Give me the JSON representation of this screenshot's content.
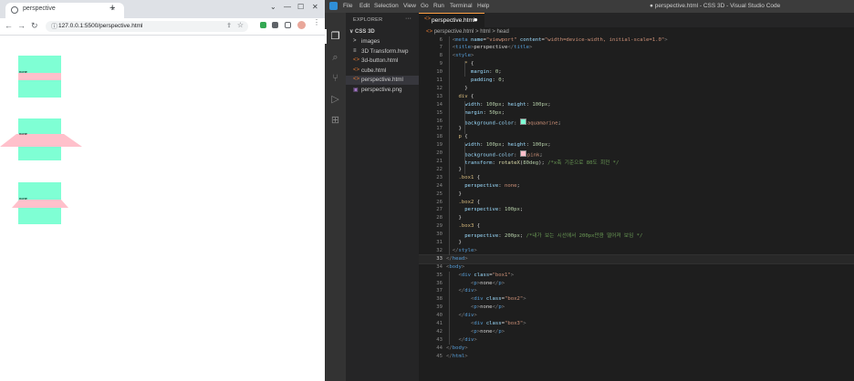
{
  "browser": {
    "tab_title": "perspective",
    "tab_close": "×",
    "new_tab": "+",
    "url": "127.0.0.1:5500/perspective.html",
    "demo_boxes": [
      {
        "class": "box1",
        "text": "none",
        "perspective": "none"
      },
      {
        "class": "box2",
        "text": "none",
        "perspective": "100px"
      },
      {
        "class": "box3",
        "text": "none",
        "perspective": "200px"
      }
    ],
    "colors": {
      "box": "#7fffd4",
      "p": "#ffc0cb"
    }
  },
  "vscode": {
    "menu": [
      "File",
      "Edit",
      "Selection",
      "View",
      "Go",
      "Run",
      "Terminal",
      "Help"
    ],
    "window_title": "● perspective.html - CSS 3D - Visual Studio Code",
    "explorer": {
      "title": "EXPLORER",
      "more": "···",
      "root": "∨ CSS 3D",
      "items": [
        {
          "label": "images",
          "icon": ">",
          "icon_name": "folder-chevron-icon",
          "active": false
        },
        {
          "label": "3D Transform.hwp",
          "icon": "≡",
          "icon_name": "hwp-file-icon",
          "active": false
        },
        {
          "label": "3d-button.html",
          "icon": "<>",
          "icon_name": "html-file-icon",
          "active": false
        },
        {
          "label": "cube.html",
          "icon": "<>",
          "icon_name": "html-file-icon",
          "active": false
        },
        {
          "label": "perspective.html",
          "icon": "<>",
          "icon_name": "html-file-icon",
          "active": true
        },
        {
          "label": "perspective.png",
          "icon": "▣",
          "icon_name": "image-file-icon",
          "active": false
        }
      ]
    },
    "editor_tab": {
      "label": "perspective.html",
      "dirty": "●"
    },
    "breadcrumbs": {
      "file": "perspective.html",
      "sep1": ">",
      "n1": "html",
      "sep2": ">",
      "n2": "head"
    },
    "code_lines": [
      {
        "n": "6",
        "html": "  <span class=\"t\">&lt;</span><span class=\"tg\">meta</span> <span class=\"at\">name</span>=<span class=\"sv\">\"viewport\"</span> <span class=\"at\">content</span>=<span class=\"sv\">\"width=device-width, initial-scale=1.0\"</span><span class=\"t\">&gt;</span>"
      },
      {
        "n": "7",
        "html": "  <span class=\"t\">&lt;</span><span class=\"tg\">title</span><span class=\"t\">&gt;</span>perspective<span class=\"t\">&lt;/</span><span class=\"tg\">title</span><span class=\"t\">&gt;</span>"
      },
      {
        "n": "8",
        "html": "  <span class=\"t\">&lt;</span><span class=\"tg\">style</span><span class=\"t\">&gt;</span>"
      },
      {
        "n": "9",
        "html": "      <span class=\"sel\">*</span> {"
      },
      {
        "n": "10",
        "html": "        <span class=\"pr\">margin</span>: <span class=\"nu\">0</span>;"
      },
      {
        "n": "11",
        "html": "        <span class=\"pr\">padding</span>: <span class=\"nu\">0</span>;"
      },
      {
        "n": "12",
        "html": "      }"
      },
      {
        "n": "13",
        "html": "    <span class=\"sel\">div</span> {"
      },
      {
        "n": "14",
        "html": "      <span class=\"pr\">width</span>: <span class=\"nu\">100px</span>; <span class=\"pr\">height</span>: <span class=\"nu\">100px</span>;"
      },
      {
        "n": "15",
        "html": "      <span class=\"pr\">margin</span>: <span class=\"nu\">50px</span>;"
      },
      {
        "n": "16",
        "html": "      <span class=\"pr\">background-color</span>: <span class=\"swatch\" style=\"background:#7fffd4\"></span><span class=\"kw\">aquamarine</span>;"
      },
      {
        "n": "17",
        "html": "    }"
      },
      {
        "n": "18",
        "html": "    <span class=\"sel\">p</span> {"
      },
      {
        "n": "19",
        "html": "      <span class=\"pr\">width</span>: <span class=\"nu\">100px</span>; <span class=\"pr\">height</span>: <span class=\"nu\">100px</span>;"
      },
      {
        "n": "20",
        "html": "      <span class=\"pr\">background-color</span>: <span class=\"swatch\" style=\"background:#ffc0cb\"></span><span class=\"kw\">pink</span>;"
      },
      {
        "n": "21",
        "html": "      <span class=\"pr\">transform</span>: <span class=\"fn\">rotateX</span>(<span class=\"nu\">80deg</span>); <span class=\"cm\">/*x축 기준으로 80도 회전 */</span>"
      },
      {
        "n": "22",
        "html": "    }"
      },
      {
        "n": "23",
        "html": "    <span class=\"sel\">.box1</span> {"
      },
      {
        "n": "24",
        "html": "      <span class=\"pr\">perspective</span>: <span class=\"kw\">none</span>;"
      },
      {
        "n": "25",
        "html": "    }"
      },
      {
        "n": "26",
        "html": "    <span class=\"sel\">.box2</span> {"
      },
      {
        "n": "27",
        "html": "      <span class=\"pr\">perspective</span>: <span class=\"nu\">100px</span>;"
      },
      {
        "n": "28",
        "html": "    }"
      },
      {
        "n": "29",
        "html": "    <span class=\"sel\">.box3</span> {"
      },
      {
        "n": "30",
        "html": "      <span class=\"pr\">perspective</span>: <span class=\"nu\">200px</span>; <span class=\"cm\">/*내가 보는 시선에서 200px만큼 떨어져 보임 */</span>"
      },
      {
        "n": "31",
        "html": "    }"
      },
      {
        "n": "32",
        "html": "  <span class=\"t\">&lt;/</span><span class=\"tg\">style</span><span class=\"t\">&gt;</span>"
      },
      {
        "n": "33",
        "html": "<span class=\"t\">&lt;/</span><span class=\"tg\">head</span><span class=\"t\">&gt;</span>"
      },
      {
        "n": "34",
        "html": "<span class=\"t\">&lt;</span><span class=\"tg\">body</span><span class=\"t\">&gt;</span>"
      },
      {
        "n": "35",
        "html": "    <span class=\"t\">&lt;</span><span class=\"tg\">div</span> <span class=\"at\">class</span>=<span class=\"sv\">\"box1\"</span><span class=\"t\">&gt;</span>"
      },
      {
        "n": "36",
        "html": "        <span class=\"t\">&lt;</span><span class=\"tg\">p</span><span class=\"t\">&gt;</span>none<span class=\"t\">&lt;/</span><span class=\"tg\">p</span><span class=\"t\">&gt;</span>"
      },
      {
        "n": "37",
        "html": "    <span class=\"t\">&lt;/</span><span class=\"tg\">div</span><span class=\"t\">&gt;</span>"
      },
      {
        "n": "38",
        "html": "        <span class=\"t\">&lt;</span><span class=\"tg\">div</span> <span class=\"at\">class</span>=<span class=\"sv\">\"box2\"</span><span class=\"t\">&gt;</span>"
      },
      {
        "n": "39",
        "html": "        <span class=\"t\">&lt;</span><span class=\"tg\">p</span><span class=\"t\">&gt;</span>none<span class=\"t\">&lt;/</span><span class=\"tg\">p</span><span class=\"t\">&gt;</span>"
      },
      {
        "n": "40",
        "html": "    <span class=\"t\">&lt;/</span><span class=\"tg\">div</span><span class=\"t\">&gt;</span>"
      },
      {
        "n": "41",
        "html": "        <span class=\"t\">&lt;</span><span class=\"tg\">div</span> <span class=\"at\">class</span>=<span class=\"sv\">\"box3\"</span><span class=\"t\">&gt;</span>"
      },
      {
        "n": "42",
        "html": "        <span class=\"t\">&lt;</span><span class=\"tg\">p</span><span class=\"t\">&gt;</span>none<span class=\"t\">&lt;/</span><span class=\"tg\">p</span><span class=\"t\">&gt;</span>"
      },
      {
        "n": "43",
        "html": "    <span class=\"t\">&lt;/</span><span class=\"tg\">div</span><span class=\"t\">&gt;</span>"
      },
      {
        "n": "44",
        "html": "<span class=\"t\">&lt;/</span><span class=\"tg\">body</span><span class=\"t\">&gt;</span>"
      },
      {
        "n": "45",
        "html": "<span class=\"t\">&lt;/</span><span class=\"tg\">html</span><span class=\"t\">&gt;</span>"
      }
    ],
    "current_line": "33"
  }
}
